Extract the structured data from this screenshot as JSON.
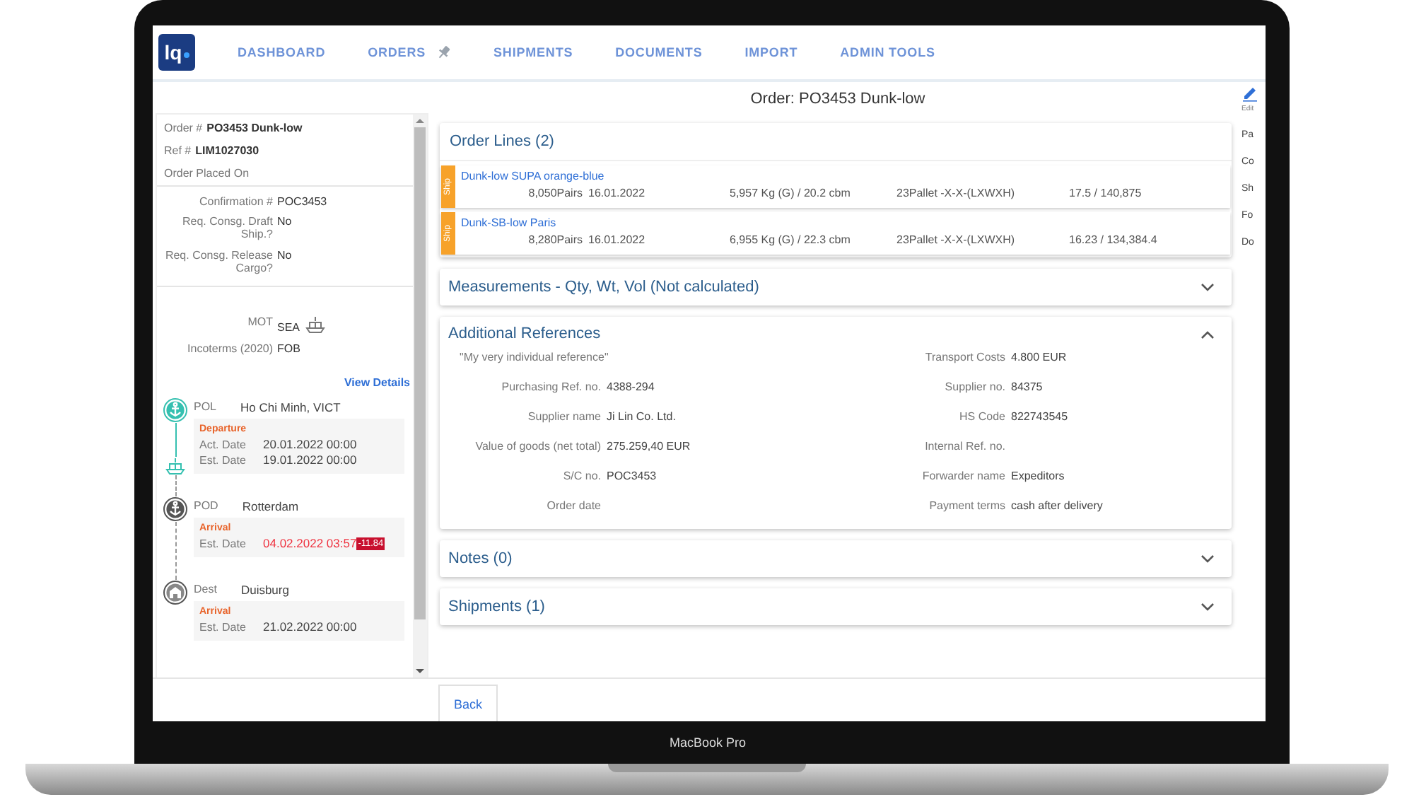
{
  "device": {
    "label": "MacBook Pro"
  },
  "nav": {
    "logo": "lq",
    "items": [
      {
        "label": "DASHBOARD",
        "pinned": false
      },
      {
        "label": "ORDERS",
        "pinned": true
      },
      {
        "label": "SHIPMENTS",
        "pinned": false
      },
      {
        "label": "DOCUMENTS",
        "pinned": false
      },
      {
        "label": "IMPORT",
        "pinned": false
      },
      {
        "label": "ADMIN TOOLS",
        "pinned": false
      }
    ]
  },
  "page_title": "Order: PO3453 Dunk-low",
  "summary": {
    "header": [
      {
        "label": "Order #",
        "value": "PO3453 Dunk-low"
      },
      {
        "label": "Ref #",
        "value": "LIM1027030"
      },
      {
        "label": "Order Placed On"
      }
    ],
    "details": [
      {
        "label": "Confirmation #",
        "value": "POC3453"
      },
      {
        "label": "Req. Consg. Draft Ship.?",
        "value": "No"
      },
      {
        "label": "Req. Consg. Release Cargo?",
        "value": "No"
      }
    ],
    "transport": [
      {
        "label": "MOT",
        "value": "SEA",
        "kind": "ship"
      },
      {
        "label": "Incoterms (2020)",
        "value": "FOB"
      }
    ],
    "view_details": "View Details",
    "route": [
      {
        "kind": "port",
        "passed": true,
        "code": "POL",
        "place": "Ho Chi Minh, VICT",
        "event": "Departure",
        "dates": [
          {
            "label": "Act. Date",
            "value": "20.01.2022 00:00",
            "late": false
          },
          {
            "label": "Est. Date",
            "value": "19.01.2022 00:00",
            "late": false
          }
        ]
      },
      {
        "kind": "port",
        "passed": false,
        "code": "POD",
        "place": "Rotterdam",
        "event": "Arrival",
        "dates": [
          {
            "label": "Est. Date",
            "value": "04.02.2022 03:57",
            "late": true,
            "badge": "-11.84"
          }
        ]
      },
      {
        "kind": "warehouse",
        "passed": false,
        "code": "Dest",
        "place": "Duisburg",
        "event": "Arrival",
        "dates": [
          {
            "label": "Est. Date",
            "value": "21.02.2022 00:00",
            "late": false
          }
        ]
      }
    ]
  },
  "order_lines": {
    "title": "Order Lines (2)",
    "lines": [
      {
        "tag": "Ship",
        "name": "Dunk-low SUPA orange-blue",
        "quantity": "8,050Pairs",
        "date": "16.01.2022",
        "weight": "5,957 Kg (G) / 20.2 cbm",
        "packing": "23Pallet  -X-X-(LXWXH)",
        "price": "17.5 / 140,875"
      },
      {
        "tag": "Ship",
        "name": "Dunk-SB-low Paris",
        "quantity": "8,280Pairs",
        "date": "16.01.2022",
        "weight": "6,955 Kg (G) / 22.3 cbm",
        "packing": "23Pallet  -X-X-(LXWXH)",
        "price": "16.23 / 134,384.4"
      }
    ]
  },
  "sections": [
    {
      "title": "Measurements - Qty, Wt, Vol (Not calculated)",
      "expanded": false
    },
    {
      "title": "Additional References",
      "expanded": true,
      "left_fields": [
        {
          "kind": "note",
          "text": "\"My very individual reference\""
        },
        {
          "label": "Purchasing Ref. no.",
          "value": "4388-294"
        },
        {
          "label": "Supplier name",
          "value": "Ji Lin Co. Ltd."
        },
        {
          "label": "Value of goods (net total)",
          "value": "275.259,40 EUR"
        },
        {
          "label": "S/C no.",
          "value": "POC3453"
        },
        {
          "label": "Order date"
        }
      ],
      "right_fields": [
        {
          "label": "Transport Costs",
          "value": "4.800 EUR"
        },
        {
          "label": "Supplier no.",
          "value": "84375"
        },
        {
          "label": "HS Code",
          "value": "822743545"
        },
        {
          "label": "Internal Ref. no."
        },
        {
          "label": "Forwarder name",
          "value": "Expeditors"
        },
        {
          "label": "Payment terms",
          "value": "cash after delivery"
        }
      ]
    },
    {
      "title": "Notes (0)",
      "expanded": false
    },
    {
      "title": "Shipments (1)",
      "expanded": false
    }
  ],
  "side_strip": {
    "edit": "Edit",
    "fragments": [
      "Pa",
      "Co",
      "Sh",
      "Fo",
      "Do"
    ]
  },
  "back_button": "Back"
}
